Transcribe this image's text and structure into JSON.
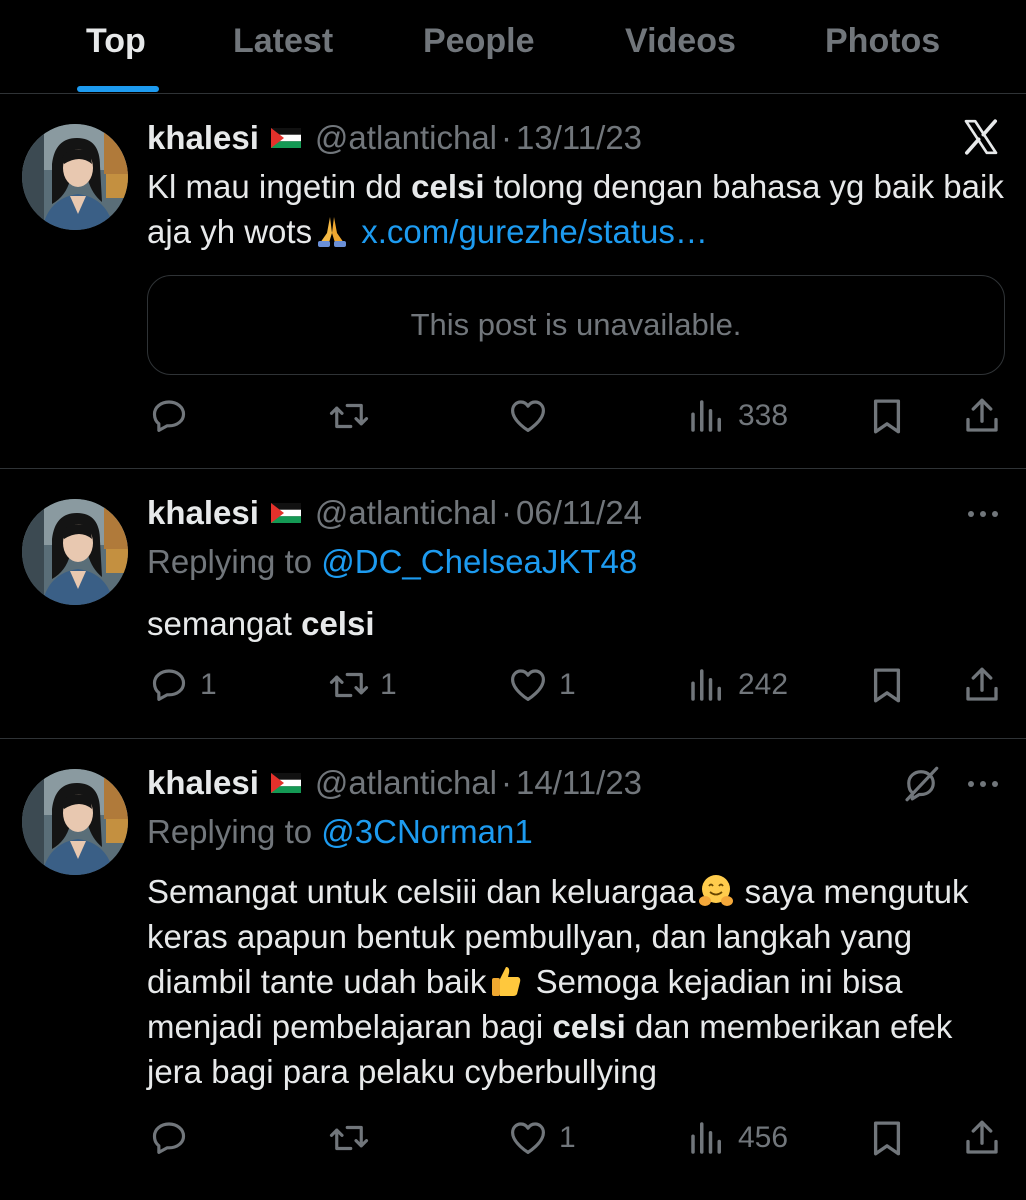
{
  "tabs": [
    {
      "label": "Top"
    },
    {
      "label": "Latest"
    },
    {
      "label": "People"
    },
    {
      "label": "Videos"
    },
    {
      "label": "Photos"
    }
  ],
  "colors": {
    "accent": "#1d9bf0",
    "text": "#e7e9ea",
    "muted": "#71767b",
    "border": "#2f3336",
    "background": "#000000"
  },
  "posts": [
    {
      "name": "khalesi",
      "handle": "@atlantichal",
      "dot": "·",
      "date": "13/11/23",
      "body_1": "Kl mau ingetin dd ",
      "body_bold": "celsi",
      "body_2": " tolong dengan bahasa yg baik baik aja yh wots",
      "link": "x.com/gurezhe/status…",
      "embed": "This post is unavailable.",
      "stats": {
        "reply": "",
        "retweet": "",
        "like": "",
        "views": "338"
      }
    },
    {
      "name": "khalesi",
      "handle": "@atlantichal",
      "dot": "·",
      "date": "06/11/24",
      "replying_label": "Replying to ",
      "replying_handle": "@DC_ChelseaJKT48",
      "body_1": "semangat ",
      "body_bold": "celsi",
      "stats": {
        "reply": "1",
        "retweet": "1",
        "like": "1",
        "views": "242"
      }
    },
    {
      "name": "khalesi",
      "handle": "@atlantichal",
      "dot": "·",
      "date": "14/11/23",
      "replying_label": "Replying to ",
      "replying_handle": "@3CNorman1",
      "body_1": "Semangat untuk celsiii dan keluargaa",
      "body_2": " saya mengutuk keras apapun bentuk pembullyan, dan langkah yang diambil tante udah baik",
      "body_3": " Semoga kejadian ini bisa menjadi pembelajaran bagi ",
      "body_bold": "celsi",
      "body_4": " dan memberikan efek jera bagi para pelaku cyberbullying",
      "stats": {
        "reply": "",
        "retweet": "",
        "like": "1",
        "views": "456"
      }
    }
  ]
}
